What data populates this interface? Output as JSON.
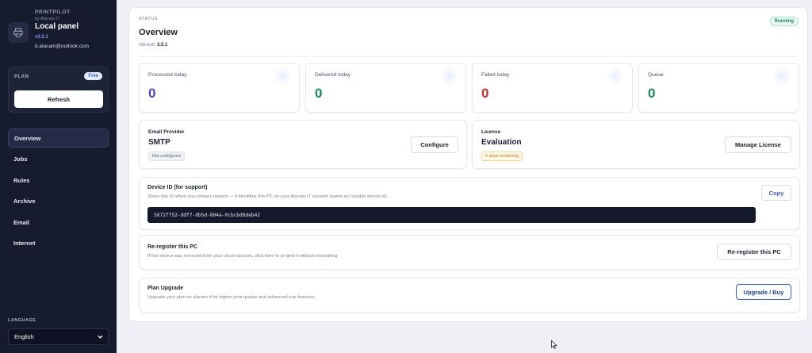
{
  "app": {
    "brand": "PRINTPILOT",
    "by": "by Alacam IT",
    "panel_title": "Local panel",
    "version": "v3.5.1",
    "email": "b.alacam@outlook.com"
  },
  "plan": {
    "label": "PLAN",
    "badge": "Free",
    "refresh_label": "Refresh"
  },
  "nav": {
    "items": [
      {
        "label": "Overview",
        "active": true
      },
      {
        "label": "Jobs"
      },
      {
        "label": "Rules"
      },
      {
        "label": "Archive"
      },
      {
        "label": "Email"
      },
      {
        "label": "Internet"
      }
    ]
  },
  "language": {
    "label": "LANGUAGE",
    "selected": "English"
  },
  "main": {
    "status_label": "STATUS",
    "title": "Overview",
    "version_label": "Version",
    "version_value": "3.5.1",
    "status_badge": "Running",
    "stats": [
      {
        "label": "Processed today",
        "value": "0",
        "color": "#4f46c8"
      },
      {
        "label": "Delivered today",
        "value": "0",
        "color": "#168a5c"
      },
      {
        "label": "Failed today",
        "value": "0",
        "color": "#d42a2a"
      },
      {
        "label": "Queue",
        "value": "0",
        "color": "#168a5c"
      }
    ],
    "email_provider": {
      "label": "Email Provider",
      "value": "SMTP",
      "status": "Not configured",
      "button": "Configure"
    },
    "license": {
      "label": "License",
      "value": "Evaluation",
      "status": "6 days remaining",
      "button": "Manage License"
    },
    "device": {
      "title": "Device ID (for support)",
      "description": "Share this ID when you contact support — it identifies this PC on your Alacam IT account (same as Lovable device id).",
      "id": "5871ff52-ddf7-db5d-804a-0cbcbd8deb42",
      "copy_label": "Copy"
    },
    "reregister": {
      "title": "Re-register this PC",
      "description": "If this device was removed from your cloud account, click here to re-bind it without reinstalling.",
      "button": "Re-register this PC"
    },
    "upgrade": {
      "title": "Plan Upgrade",
      "description": "Upgrade your plan on alacam.it for higher print quotas and advanced rule features.",
      "button": "Upgrade / Buy"
    }
  },
  "colors": {
    "sidebar_bg": "#161b2e",
    "accent": "#3b5bdb",
    "running": "#16875c"
  }
}
